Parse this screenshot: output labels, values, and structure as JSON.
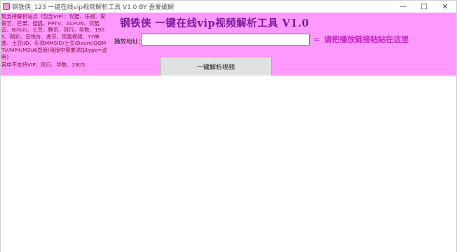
{
  "window": {
    "title": "钢铁侠_123   一键在线vip视频解析工具 V1.0  BY 吾爱破解",
    "min_label": "—",
    "max_label": "□",
    "close_label": "✕"
  },
  "panel": {
    "background": "#ff99ff",
    "sites_text": "现支持解析站点（包含VIP）：优酷、乐视、爱奇艺、芒果、搜狐、PPTV、ACFUN、优酷云、Bilibili、土豆、腾讯、风行、华数、1905、精彩、音悦台、虎牙、凤凰视频、YY神曲、土豆IID、乐视MMSID/土豆/Dvum/QQMTV/MP4/M3U8直链(链接中需要添加type=说明)",
    "unsupported_text": "其中不支持VIP：风行、华数、1905",
    "heading": "钢铁侠    一键在线vip视频解析工具 V1.0",
    "url_label": "播放地址：",
    "url_value": "",
    "url_placeholder": "",
    "hint_arrow": "⇐",
    "hint_text": "请把播放链接粘贴在这里",
    "parse_button_label": "一键解析视频"
  },
  "colors": {
    "panel": "#ff99ff",
    "heading": "#7a1aa0",
    "hint": "#cc22cc",
    "sites_text": "#8a1040"
  },
  "icons": {
    "app": "app-icon",
    "arrow": "left-arrow-icon"
  }
}
